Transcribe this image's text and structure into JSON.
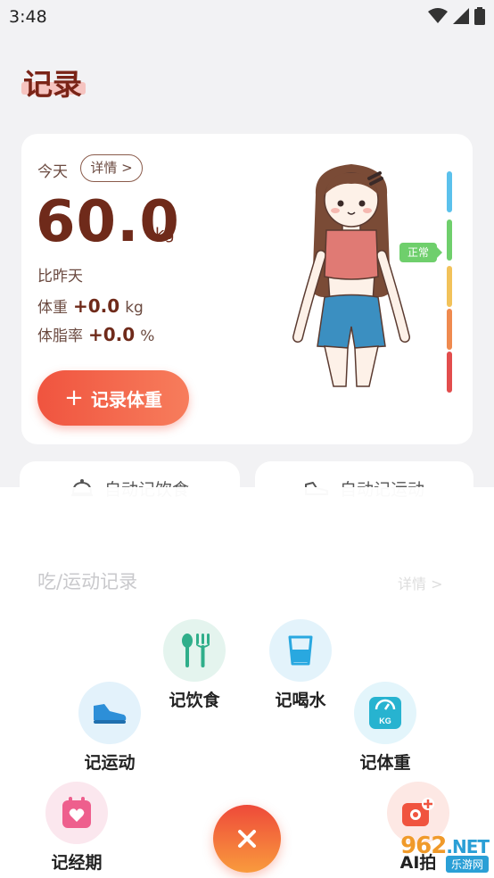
{
  "status_bar": {
    "time": "3:48"
  },
  "page": {
    "title": "记录"
  },
  "weight_card": {
    "today_label": "今天",
    "detail_label": "详情 >",
    "weight": "60.0",
    "unit": "kg",
    "compare_label": "比昨天",
    "weight_label": "体重",
    "weight_delta": "+0.0",
    "weight_delta_unit": "kg",
    "fat_label": "体脂率",
    "fat_delta": "+0.0",
    "fat_delta_unit": "%",
    "record_button": "记录体重",
    "status_tag": "正常",
    "scale_colors": [
      "#5bc1ec",
      "#6fcf6c",
      "#f2c25a",
      "#ef8a4f",
      "#e24d4d"
    ]
  },
  "auto_tiles": {
    "food": "自动记饮食",
    "sport": "自动记运动"
  },
  "records": {
    "title": "吃/运动记录",
    "detail": "详情 >"
  },
  "quick_actions": {
    "diet": "记饮食",
    "water": "记喝水",
    "exercise": "记运动",
    "weight": "记体重",
    "period": "记经期",
    "photo": "AI拍"
  },
  "watermark": {
    "brand": "962",
    "net": ".NET",
    "sub": "乐游网"
  },
  "colors": {
    "accent": "#f0543f",
    "title": "#7a2417",
    "normal": "#6fcf6c"
  }
}
